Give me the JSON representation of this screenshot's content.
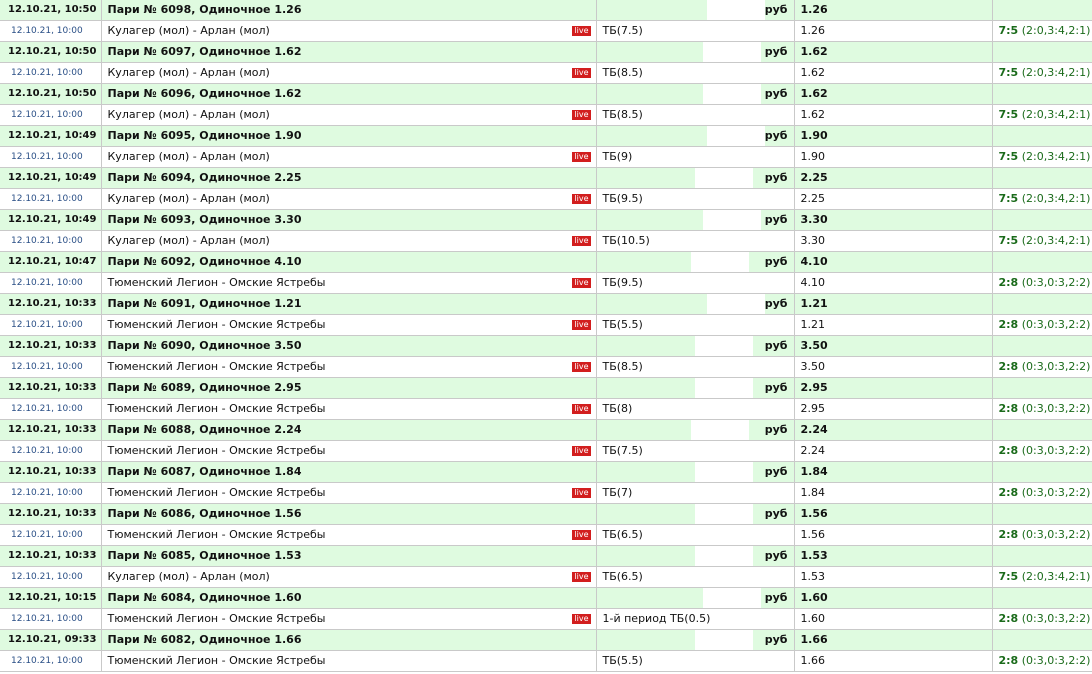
{
  "currency": "руб",
  "live_label": "live",
  "rows": [
    {
      "bet_date": "12.10.21, 10:50",
      "bet_title": "Пари № 6098, Одиночное 1.26",
      "bet_odds": "1.26",
      "event_date": "12.10.21, 10:00",
      "match": "Кулагер (мол) - Арлан (мол)",
      "live": true,
      "market": "ТБ(7.5)",
      "odds": "1.26",
      "score_main": "7:5",
      "score_detail": "(2:0,3:4,2:1)"
    },
    {
      "bet_date": "12.10.21, 10:50",
      "bet_title": "Пари № 6097, Одиночное 1.62",
      "bet_odds": "1.62",
      "event_date": "12.10.21, 10:00",
      "match": "Кулагер (мол) - Арлан (мол)",
      "live": true,
      "market": "ТБ(8.5)",
      "odds": "1.62",
      "score_main": "7:5",
      "score_detail": "(2:0,3:4,2:1)"
    },
    {
      "bet_date": "12.10.21, 10:50",
      "bet_title": "Пари № 6096, Одиночное 1.62",
      "bet_odds": "1.62",
      "event_date": "12.10.21, 10:00",
      "match": "Кулагер (мол) - Арлан (мол)",
      "live": true,
      "market": "ТБ(8.5)",
      "odds": "1.62",
      "score_main": "7:5",
      "score_detail": "(2:0,3:4,2:1)"
    },
    {
      "bet_date": "12.10.21, 10:49",
      "bet_title": "Пари № 6095, Одиночное 1.90",
      "bet_odds": "1.90",
      "event_date": "12.10.21, 10:00",
      "match": "Кулагер (мол) - Арлан (мол)",
      "live": true,
      "market": "ТБ(9)",
      "odds": "1.90",
      "score_main": "7:5",
      "score_detail": "(2:0,3:4,2:1)"
    },
    {
      "bet_date": "12.10.21, 10:49",
      "bet_title": "Пари № 6094, Одиночное 2.25",
      "bet_odds": "2.25",
      "event_date": "12.10.21, 10:00",
      "match": "Кулагер (мол) - Арлан (мол)",
      "live": true,
      "market": "ТБ(9.5)",
      "odds": "2.25",
      "score_main": "7:5",
      "score_detail": "(2:0,3:4,2:1)"
    },
    {
      "bet_date": "12.10.21, 10:49",
      "bet_title": "Пари № 6093, Одиночное 3.30",
      "bet_odds": "3.30",
      "event_date": "12.10.21, 10:00",
      "match": "Кулагер (мол) - Арлан (мол)",
      "live": true,
      "market": "ТБ(10.5)",
      "odds": "3.30",
      "score_main": "7:5",
      "score_detail": "(2:0,3:4,2:1)"
    },
    {
      "bet_date": "12.10.21, 10:47",
      "bet_title": "Пари № 6092, Одиночное 4.10",
      "bet_odds": "4.10",
      "event_date": "12.10.21, 10:00",
      "match": "Тюменский Легион - Омские Ястребы",
      "live": true,
      "market": "ТБ(9.5)",
      "odds": "4.10",
      "score_main": "2:8",
      "score_detail": "(0:3,0:3,2:2)"
    },
    {
      "bet_date": "12.10.21, 10:33",
      "bet_title": "Пари № 6091, Одиночное 1.21",
      "bet_odds": "1.21",
      "event_date": "12.10.21, 10:00",
      "match": "Тюменский Легион - Омские Ястребы",
      "live": true,
      "market": "ТБ(5.5)",
      "odds": "1.21",
      "score_main": "2:8",
      "score_detail": "(0:3,0:3,2:2)"
    },
    {
      "bet_date": "12.10.21, 10:33",
      "bet_title": "Пари № 6090, Одиночное 3.50",
      "bet_odds": "3.50",
      "event_date": "12.10.21, 10:00",
      "match": "Тюменский Легион - Омские Ястребы",
      "live": true,
      "market": "ТБ(8.5)",
      "odds": "3.50",
      "score_main": "2:8",
      "score_detail": "(0:3,0:3,2:2)"
    },
    {
      "bet_date": "12.10.21, 10:33",
      "bet_title": "Пари № 6089, Одиночное 2.95",
      "bet_odds": "2.95",
      "event_date": "12.10.21, 10:00",
      "match": "Тюменский Легион - Омские Ястребы",
      "live": true,
      "market": "ТБ(8)",
      "odds": "2.95",
      "score_main": "2:8",
      "score_detail": "(0:3,0:3,2:2)"
    },
    {
      "bet_date": "12.10.21, 10:33",
      "bet_title": "Пари № 6088, Одиночное 2.24",
      "bet_odds": "2.24",
      "event_date": "12.10.21, 10:00",
      "match": "Тюменский Легион - Омские Ястребы",
      "live": true,
      "market": "ТБ(7.5)",
      "odds": "2.24",
      "score_main": "2:8",
      "score_detail": "(0:3,0:3,2:2)"
    },
    {
      "bet_date": "12.10.21, 10:33",
      "bet_title": "Пари № 6087, Одиночное 1.84",
      "bet_odds": "1.84",
      "event_date": "12.10.21, 10:00",
      "match": "Тюменский Легион - Омские Ястребы",
      "live": true,
      "market": "ТБ(7)",
      "odds": "1.84",
      "score_main": "2:8",
      "score_detail": "(0:3,0:3,2:2)"
    },
    {
      "bet_date": "12.10.21, 10:33",
      "bet_title": "Пари № 6086, Одиночное 1.56",
      "bet_odds": "1.56",
      "event_date": "12.10.21, 10:00",
      "match": "Тюменский Легион - Омские Ястребы",
      "live": true,
      "market": "ТБ(6.5)",
      "odds": "1.56",
      "score_main": "2:8",
      "score_detail": "(0:3,0:3,2:2)"
    },
    {
      "bet_date": "12.10.21, 10:33",
      "bet_title": "Пари № 6085, Одиночное 1.53",
      "bet_odds": "1.53",
      "event_date": "12.10.21, 10:00",
      "match": "Кулагер (мол) - Арлан (мол)",
      "live": true,
      "market": "ТБ(6.5)",
      "odds": "1.53",
      "score_main": "7:5",
      "score_detail": "(2:0,3:4,2:1)"
    },
    {
      "bet_date": "12.10.21, 10:15",
      "bet_title": "Пари № 6084, Одиночное 1.60",
      "bet_odds": "1.60",
      "event_date": "12.10.21, 10:00",
      "match": "Тюменский Легион - Омские Ястребы",
      "live": true,
      "market": "1-й период ТБ(0.5)",
      "odds": "1.60",
      "score_main": "2:8",
      "score_detail": "(0:3,0:3,2:2)"
    },
    {
      "bet_date": "12.10.21, 09:33",
      "bet_title": "Пари № 6082, Одиночное 1.66",
      "bet_odds": "1.66",
      "event_date": "12.10.21, 10:00",
      "match": "Тюменский Легион - Омские Ястребы",
      "live": false,
      "market": "ТБ(5.5)",
      "odds": "1.66",
      "score_main": "2:8",
      "score_detail": "(0:3,0:3,2:2)"
    }
  ]
}
